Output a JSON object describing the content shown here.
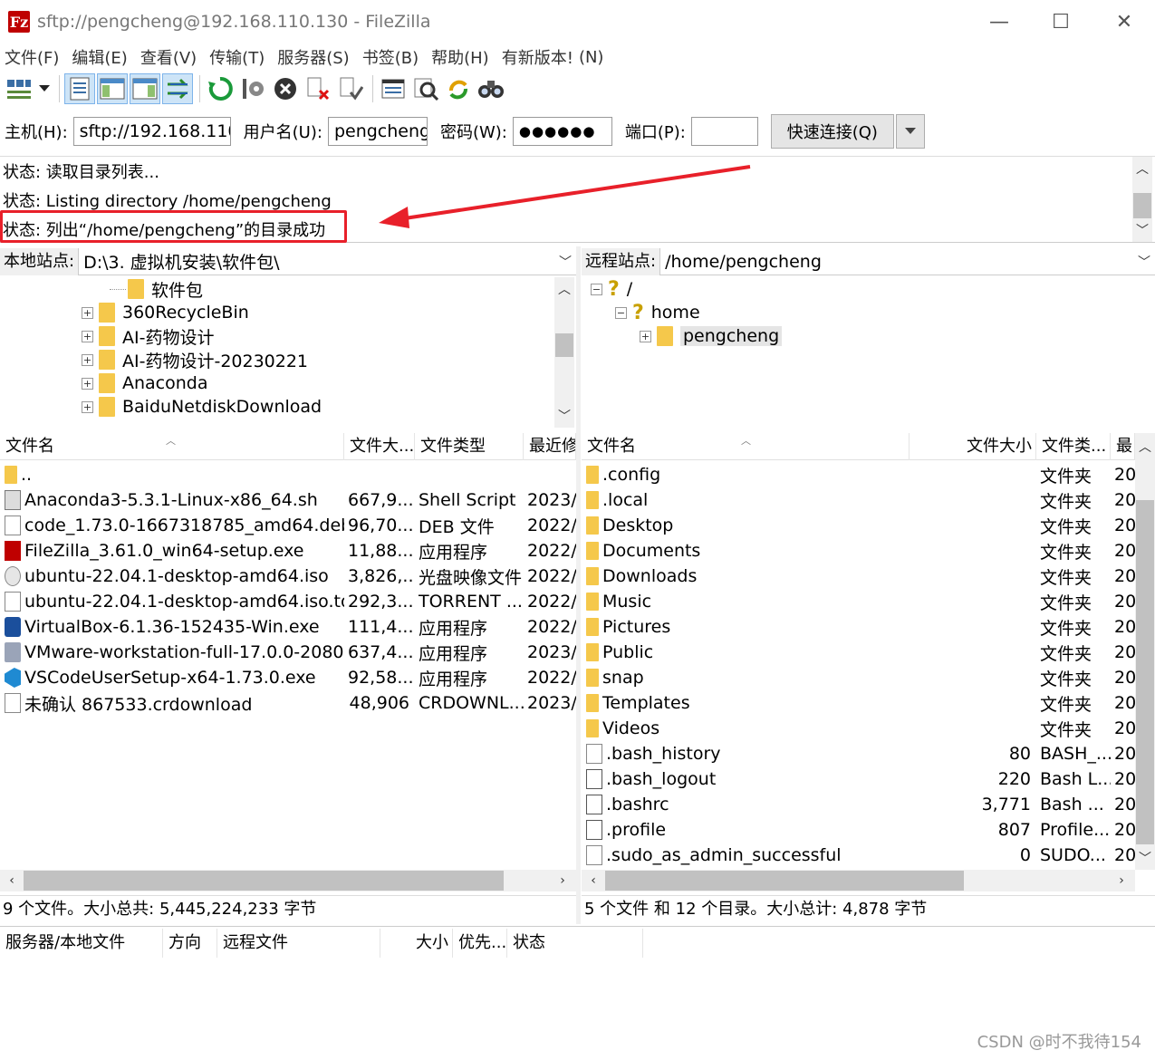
{
  "window": {
    "title": "sftp://pengcheng@192.168.110.130 - FileZilla",
    "logo_glyph": "Fz",
    "minimize": "—",
    "maximize": "☐",
    "close": "✕"
  },
  "menu": [
    "文件(F)",
    "编辑(E)",
    "查看(V)",
    "传输(T)",
    "服务器(S)",
    "书签(B)",
    "帮助(H)",
    "有新版本!",
    "(N)"
  ],
  "toolbar_icons": [
    "site-manager-icon",
    "dropdown-arrow-icon",
    "toggle-log-icon",
    "toggle-local-tree-icon",
    "toggle-remote-tree-icon",
    "toggle-queue-icon",
    "refresh-icon",
    "process-queue-icon",
    "cancel-icon",
    "disconnect-icon",
    "reconnect-icon",
    "filter-icon",
    "compare-icon",
    "sync-browse-icon",
    "search-icon"
  ],
  "quickconnect": {
    "host_label": "主机(H):",
    "host_value": "sftp://192.168.110.",
    "user_label": "用户名(U):",
    "user_value": "pengcheng",
    "pass_label": "密码(W):",
    "pass_value": "●●●●●●",
    "port_label": "端口(P):",
    "port_value": "",
    "connect_label": "快速连接(Q)"
  },
  "log": [
    "状态: 读取目录列表...",
    "状态: Listing directory /home/pengcheng",
    "状态: 列出“/home/pengcheng”的目录成功"
  ],
  "local": {
    "site_label": "本地站点:",
    "path": "D:\\3. 虚拟机安装\\软件包\\",
    "tree": [
      {
        "name": "软件包",
        "expander": ""
      },
      {
        "name": "360RecycleBin",
        "expander": "+"
      },
      {
        "name": "AI-药物设计",
        "expander": "+"
      },
      {
        "name": "AI-药物设计-20230221",
        "expander": "+"
      },
      {
        "name": "Anaconda",
        "expander": "+"
      },
      {
        "name": "BaiduNetdiskDownload",
        "expander": "+"
      }
    ],
    "columns": [
      "文件名",
      "文件大...",
      "文件类型",
      "最近修"
    ],
    "files": [
      {
        "name": "..",
        "size": "",
        "type": "",
        "date": "",
        "icon": "folder"
      },
      {
        "name": "Anaconda3-5.3.1-Linux-x86_64.sh",
        "size": "667,9...",
        "type": "Shell Script",
        "date": "2023/",
        "icon": "sh"
      },
      {
        "name": "code_1.73.0-1667318785_amd64.deb",
        "size": "96,70...",
        "type": "DEB 文件",
        "date": "2022/",
        "icon": "file"
      },
      {
        "name": "FileZilla_3.61.0_win64-setup.exe",
        "size": "11,88...",
        "type": "应用程序",
        "date": "2022/",
        "icon": "fz"
      },
      {
        "name": "ubuntu-22.04.1-desktop-amd64.iso",
        "size": "3,826,...",
        "type": "光盘映像文件",
        "date": "2022/",
        "icon": "iso"
      },
      {
        "name": "ubuntu-22.04.1-desktop-amd64.iso.to...",
        "size": "292,3...",
        "type": "TORRENT ...",
        "date": "2022/",
        "icon": "file"
      },
      {
        "name": "VirtualBox-6.1.36-152435-Win.exe",
        "size": "111,4...",
        "type": "应用程序",
        "date": "2022/",
        "icon": "vbox"
      },
      {
        "name": "VMware-workstation-full-17.0.0-2080...",
        "size": "637,4...",
        "type": "应用程序",
        "date": "2023/",
        "icon": "vmw"
      },
      {
        "name": "VSCodeUserSetup-x64-1.73.0.exe",
        "size": "92,58...",
        "type": "应用程序",
        "date": "2022/",
        "icon": "vsc"
      },
      {
        "name": "未确认 867533.crdownload",
        "size": "48,906",
        "type": "CRDOWNL...",
        "date": "2023/",
        "icon": "file"
      }
    ],
    "status": "9 个文件。大小总共: 5,445,224,233 字节"
  },
  "remote": {
    "site_label": "远程站点:",
    "path": "/home/pengcheng",
    "tree": [
      {
        "name": "/",
        "expander": "−",
        "icon": "question"
      },
      {
        "name": "home",
        "expander": "−",
        "icon": "question"
      },
      {
        "name": "pengcheng",
        "expander": "+",
        "icon": "folder"
      }
    ],
    "columns": [
      "文件名",
      "文件大小",
      "文件类...",
      "最"
    ],
    "files": [
      {
        "name": ".config",
        "size": "",
        "type": "文件夹",
        "date": "20",
        "icon": "folder"
      },
      {
        "name": ".local",
        "size": "",
        "type": "文件夹",
        "date": "20",
        "icon": "folder"
      },
      {
        "name": "Desktop",
        "size": "",
        "type": "文件夹",
        "date": "20",
        "icon": "folder"
      },
      {
        "name": "Documents",
        "size": "",
        "type": "文件夹",
        "date": "20",
        "icon": "folder"
      },
      {
        "name": "Downloads",
        "size": "",
        "type": "文件夹",
        "date": "20",
        "icon": "folder"
      },
      {
        "name": "Music",
        "size": "",
        "type": "文件夹",
        "date": "20",
        "icon": "folder"
      },
      {
        "name": "Pictures",
        "size": "",
        "type": "文件夹",
        "date": "20",
        "icon": "folder"
      },
      {
        "name": "Public",
        "size": "",
        "type": "文件夹",
        "date": "20",
        "icon": "folder"
      },
      {
        "name": "snap",
        "size": "",
        "type": "文件夹",
        "date": "20",
        "icon": "folder"
      },
      {
        "name": "Templates",
        "size": "",
        "type": "文件夹",
        "date": "20",
        "icon": "folder"
      },
      {
        "name": "Videos",
        "size": "",
        "type": "文件夹",
        "date": "20",
        "icon": "folder"
      },
      {
        "name": ".bash_history",
        "size": "80",
        "type": "BASH_...",
        "date": "20",
        "icon": "file"
      },
      {
        "name": ".bash_logout",
        "size": "220",
        "type": "Bash L...",
        "date": "20",
        "icon": "doc"
      },
      {
        "name": ".bashrc",
        "size": "3,771",
        "type": "Bash ...",
        "date": "20",
        "icon": "doc"
      },
      {
        "name": ".profile",
        "size": "807",
        "type": "Profile...",
        "date": "20",
        "icon": "doc"
      },
      {
        "name": ".sudo_as_admin_successful",
        "size": "0",
        "type": "SUDO...",
        "date": "20",
        "icon": "file"
      }
    ],
    "status": "5 个文件 和 12 个目录。大小总计: 4,878 字节"
  },
  "queue": {
    "columns": [
      "服务器/本地文件",
      "方向",
      "远程文件",
      "大小",
      "优先...",
      "状态"
    ]
  },
  "watermark": "CSDN @时不我待154",
  "colors": {
    "highlight": "#e8202a",
    "folder": "#f5c84b",
    "brand": "#bf0000"
  }
}
